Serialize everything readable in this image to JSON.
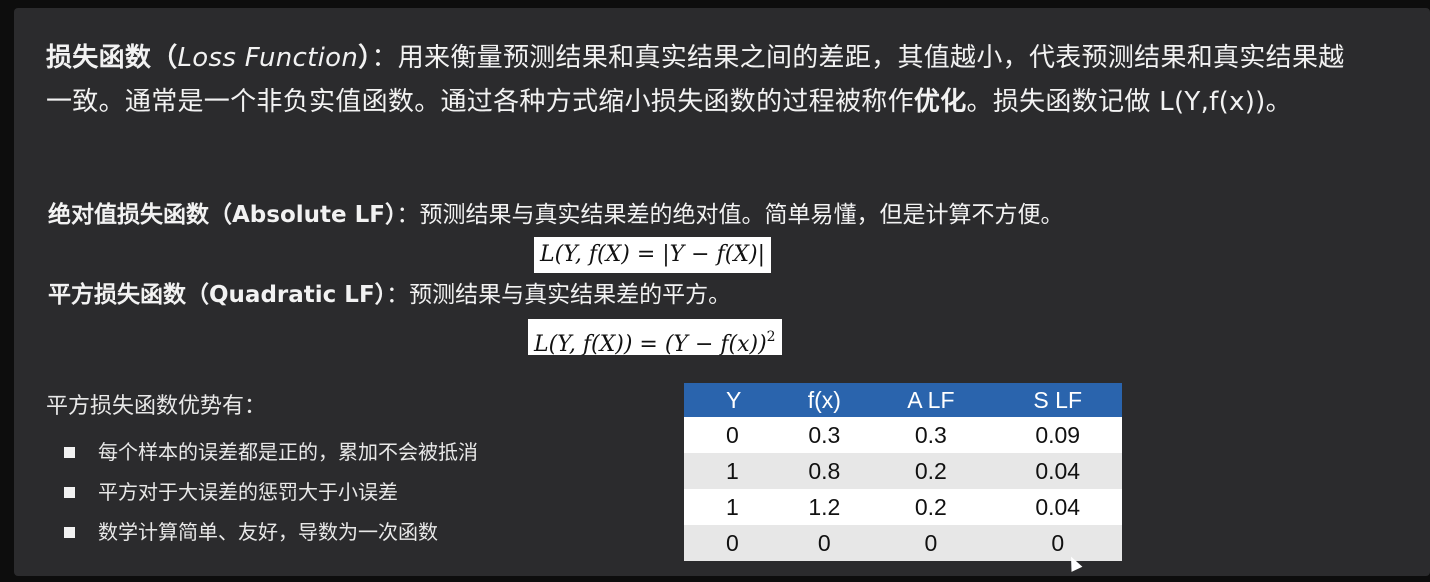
{
  "intro": {
    "term": "损失函数（",
    "term_en": "Loss Function",
    "term_close": "）",
    "definition": "：用来衡量预测结果和真实结果之间的差距，其值越小，代表预测结果和真实结果越一致。通常是一个非负实值函数。通过各种方式缩小损失函数的过程被称作",
    "optimization": "优化",
    "notation": "。损失函数记做 L(Y,f(x))。"
  },
  "absolute": {
    "title": "绝对值损失函数（Absolute LF）",
    "desc": "：预测结果与真实结果差的绝对值。简单易懂，但是计算不方便。",
    "formula": "L(Y, f(X) = |Y − f(X)|"
  },
  "quadratic": {
    "title": "平方损失函数（Quadratic LF）",
    "desc": "：预测结果与真实结果差的平方。",
    "formula": "L(Y, f(X)) = (Y − f(x))",
    "exponent": "2"
  },
  "advantages": {
    "title": "平方损失函数优势有：",
    "items": [
      "每个样本的误差都是正的，累加不会被抵消",
      "平方对于大误差的惩罚大于小误差",
      "数学计算简单、友好，导数为一次函数"
    ]
  },
  "table": {
    "headers": [
      "Y",
      "f(x)",
      "A LF",
      "S LF"
    ],
    "rows": [
      [
        "0",
        "0.3",
        "0.3",
        "0.09"
      ],
      [
        "1",
        "0.8",
        "0.2",
        "0.04"
      ],
      [
        "1",
        "1.2",
        "0.2",
        "0.04"
      ],
      [
        "0",
        "0",
        "0",
        "0"
      ]
    ],
    "header_color": "#2a64ad"
  }
}
